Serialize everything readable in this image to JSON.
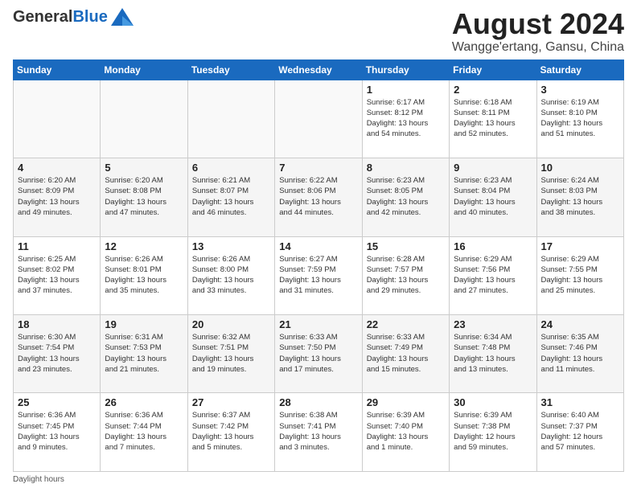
{
  "header": {
    "logo_line1": "General",
    "logo_line2": "Blue",
    "main_title": "August 2024",
    "subtitle": "Wangge'ertang, Gansu, China"
  },
  "days_of_week": [
    "Sunday",
    "Monday",
    "Tuesday",
    "Wednesday",
    "Thursday",
    "Friday",
    "Saturday"
  ],
  "weeks": [
    [
      {
        "day": "",
        "info": ""
      },
      {
        "day": "",
        "info": ""
      },
      {
        "day": "",
        "info": ""
      },
      {
        "day": "",
        "info": ""
      },
      {
        "day": "1",
        "info": "Sunrise: 6:17 AM\nSunset: 8:12 PM\nDaylight: 13 hours\nand 54 minutes."
      },
      {
        "day": "2",
        "info": "Sunrise: 6:18 AM\nSunset: 8:11 PM\nDaylight: 13 hours\nand 52 minutes."
      },
      {
        "day": "3",
        "info": "Sunrise: 6:19 AM\nSunset: 8:10 PM\nDaylight: 13 hours\nand 51 minutes."
      }
    ],
    [
      {
        "day": "4",
        "info": "Sunrise: 6:20 AM\nSunset: 8:09 PM\nDaylight: 13 hours\nand 49 minutes."
      },
      {
        "day": "5",
        "info": "Sunrise: 6:20 AM\nSunset: 8:08 PM\nDaylight: 13 hours\nand 47 minutes."
      },
      {
        "day": "6",
        "info": "Sunrise: 6:21 AM\nSunset: 8:07 PM\nDaylight: 13 hours\nand 46 minutes."
      },
      {
        "day": "7",
        "info": "Sunrise: 6:22 AM\nSunset: 8:06 PM\nDaylight: 13 hours\nand 44 minutes."
      },
      {
        "day": "8",
        "info": "Sunrise: 6:23 AM\nSunset: 8:05 PM\nDaylight: 13 hours\nand 42 minutes."
      },
      {
        "day": "9",
        "info": "Sunrise: 6:23 AM\nSunset: 8:04 PM\nDaylight: 13 hours\nand 40 minutes."
      },
      {
        "day": "10",
        "info": "Sunrise: 6:24 AM\nSunset: 8:03 PM\nDaylight: 13 hours\nand 38 minutes."
      }
    ],
    [
      {
        "day": "11",
        "info": "Sunrise: 6:25 AM\nSunset: 8:02 PM\nDaylight: 13 hours\nand 37 minutes."
      },
      {
        "day": "12",
        "info": "Sunrise: 6:26 AM\nSunset: 8:01 PM\nDaylight: 13 hours\nand 35 minutes."
      },
      {
        "day": "13",
        "info": "Sunrise: 6:26 AM\nSunset: 8:00 PM\nDaylight: 13 hours\nand 33 minutes."
      },
      {
        "day": "14",
        "info": "Sunrise: 6:27 AM\nSunset: 7:59 PM\nDaylight: 13 hours\nand 31 minutes."
      },
      {
        "day": "15",
        "info": "Sunrise: 6:28 AM\nSunset: 7:57 PM\nDaylight: 13 hours\nand 29 minutes."
      },
      {
        "day": "16",
        "info": "Sunrise: 6:29 AM\nSunset: 7:56 PM\nDaylight: 13 hours\nand 27 minutes."
      },
      {
        "day": "17",
        "info": "Sunrise: 6:29 AM\nSunset: 7:55 PM\nDaylight: 13 hours\nand 25 minutes."
      }
    ],
    [
      {
        "day": "18",
        "info": "Sunrise: 6:30 AM\nSunset: 7:54 PM\nDaylight: 13 hours\nand 23 minutes."
      },
      {
        "day": "19",
        "info": "Sunrise: 6:31 AM\nSunset: 7:53 PM\nDaylight: 13 hours\nand 21 minutes."
      },
      {
        "day": "20",
        "info": "Sunrise: 6:32 AM\nSunset: 7:51 PM\nDaylight: 13 hours\nand 19 minutes."
      },
      {
        "day": "21",
        "info": "Sunrise: 6:33 AM\nSunset: 7:50 PM\nDaylight: 13 hours\nand 17 minutes."
      },
      {
        "day": "22",
        "info": "Sunrise: 6:33 AM\nSunset: 7:49 PM\nDaylight: 13 hours\nand 15 minutes."
      },
      {
        "day": "23",
        "info": "Sunrise: 6:34 AM\nSunset: 7:48 PM\nDaylight: 13 hours\nand 13 minutes."
      },
      {
        "day": "24",
        "info": "Sunrise: 6:35 AM\nSunset: 7:46 PM\nDaylight: 13 hours\nand 11 minutes."
      }
    ],
    [
      {
        "day": "25",
        "info": "Sunrise: 6:36 AM\nSunset: 7:45 PM\nDaylight: 13 hours\nand 9 minutes."
      },
      {
        "day": "26",
        "info": "Sunrise: 6:36 AM\nSunset: 7:44 PM\nDaylight: 13 hours\nand 7 minutes."
      },
      {
        "day": "27",
        "info": "Sunrise: 6:37 AM\nSunset: 7:42 PM\nDaylight: 13 hours\nand 5 minutes."
      },
      {
        "day": "28",
        "info": "Sunrise: 6:38 AM\nSunset: 7:41 PM\nDaylight: 13 hours\nand 3 minutes."
      },
      {
        "day": "29",
        "info": "Sunrise: 6:39 AM\nSunset: 7:40 PM\nDaylight: 13 hours\nand 1 minute."
      },
      {
        "day": "30",
        "info": "Sunrise: 6:39 AM\nSunset: 7:38 PM\nDaylight: 12 hours\nand 59 minutes."
      },
      {
        "day": "31",
        "info": "Sunrise: 6:40 AM\nSunset: 7:37 PM\nDaylight: 12 hours\nand 57 minutes."
      }
    ]
  ],
  "footer": {
    "note": "Daylight hours"
  }
}
